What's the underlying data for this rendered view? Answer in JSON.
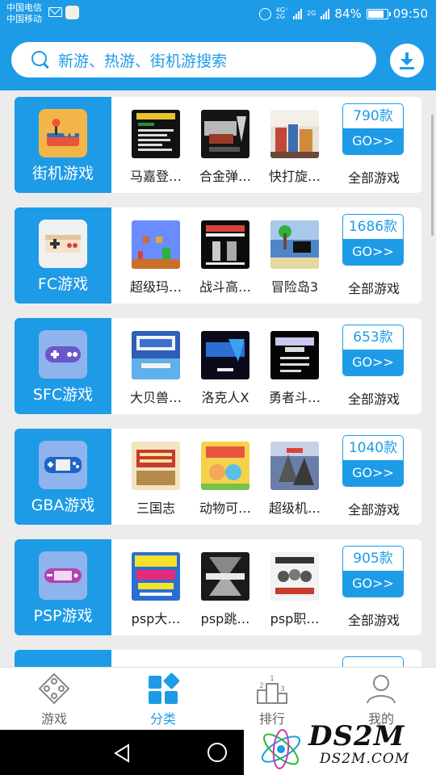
{
  "status_bar": {
    "carrier_1": "中国电信",
    "carrier_2": "中国移动",
    "network_1": "4G⁺",
    "network_2": "2G",
    "network_3": "2G",
    "battery": "84%",
    "battery_level": 0.84,
    "time": "09:50"
  },
  "header": {
    "search_placeholder": "新游、热游、街机游搜索",
    "icons": [
      "search-icon",
      "download-icon"
    ]
  },
  "categories": [
    {
      "label": "街机游戏",
      "icon": "arcade-joystick-icon",
      "games": [
        "马嘉登…",
        "合金弹…",
        "快打旋…"
      ],
      "count": "790款",
      "go": "GO>>",
      "all": "全部游戏"
    },
    {
      "label": "FC游戏",
      "icon": "fc-gamepad-icon",
      "games": [
        "超级玛…",
        "战斗高…",
        "冒险岛3"
      ],
      "count": "1686款",
      "go": "GO>>",
      "all": "全部游戏"
    },
    {
      "label": "SFC游戏",
      "icon": "sfc-gamepad-icon",
      "games": [
        "大贝兽…",
        "洛克人X",
        "勇者斗…"
      ],
      "count": "653款",
      "go": "GO>>",
      "all": "全部游戏"
    },
    {
      "label": "GBA游戏",
      "icon": "gba-handheld-icon",
      "games": [
        "三国志",
        "动物可…",
        "超级机…"
      ],
      "count": "1040款",
      "go": "GO>>",
      "all": "全部游戏"
    },
    {
      "label": "PSP游戏",
      "icon": "psp-handheld-icon",
      "games": [
        "psp大…",
        "psp跳…",
        "psp职…"
      ],
      "count": "905款",
      "go": "GO>>",
      "all": "全部游戏"
    }
  ],
  "tabs": [
    {
      "label": "游戏",
      "icon": "gamepad-tab-icon",
      "active": false
    },
    {
      "label": "分类",
      "icon": "category-tab-icon",
      "active": true
    },
    {
      "label": "排行",
      "icon": "ranking-podium-icon",
      "active": false
    },
    {
      "label": "我的",
      "icon": "profile-tab-icon",
      "active": false
    }
  ],
  "watermark": {
    "title": "DS2M",
    "url": "DS2M.COM"
  },
  "colors": {
    "accent": "#1e9be6",
    "card": "#ffffff",
    "background": "#ececec"
  }
}
